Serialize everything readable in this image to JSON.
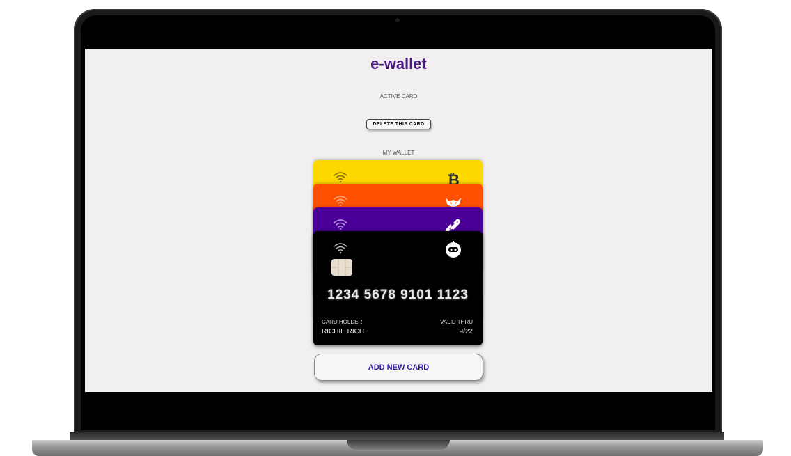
{
  "app": {
    "title": "e-wallet"
  },
  "labels": {
    "active_card": "ACTIVE CARD",
    "my_wallet": "MY WALLET"
  },
  "buttons": {
    "delete_card": "DELETE THIS CARD",
    "add_card": "ADD NEW CARD"
  },
  "active_card": {
    "number": "1234 5678 9101 1123",
    "holder_label": "CARD HOLDER",
    "holder_name": "RICHIE RICH",
    "valid_label": "VALID THRU",
    "valid_value": "9/22",
    "color": "#000000",
    "brand_icon": "robot-icon"
  },
  "wallet_cards": [
    {
      "color": "#ffd800",
      "brand_icon": "bitcoin-icon"
    },
    {
      "color": "#ff4f00",
      "brand_icon": "devil-icon"
    },
    {
      "color": "#4a0096",
      "brand_icon": "chain-link-icon"
    }
  ],
  "colors": {
    "title": "#4a1a80",
    "add_button_text": "#2a1aa8",
    "screen_bg": "#f1eff0"
  }
}
